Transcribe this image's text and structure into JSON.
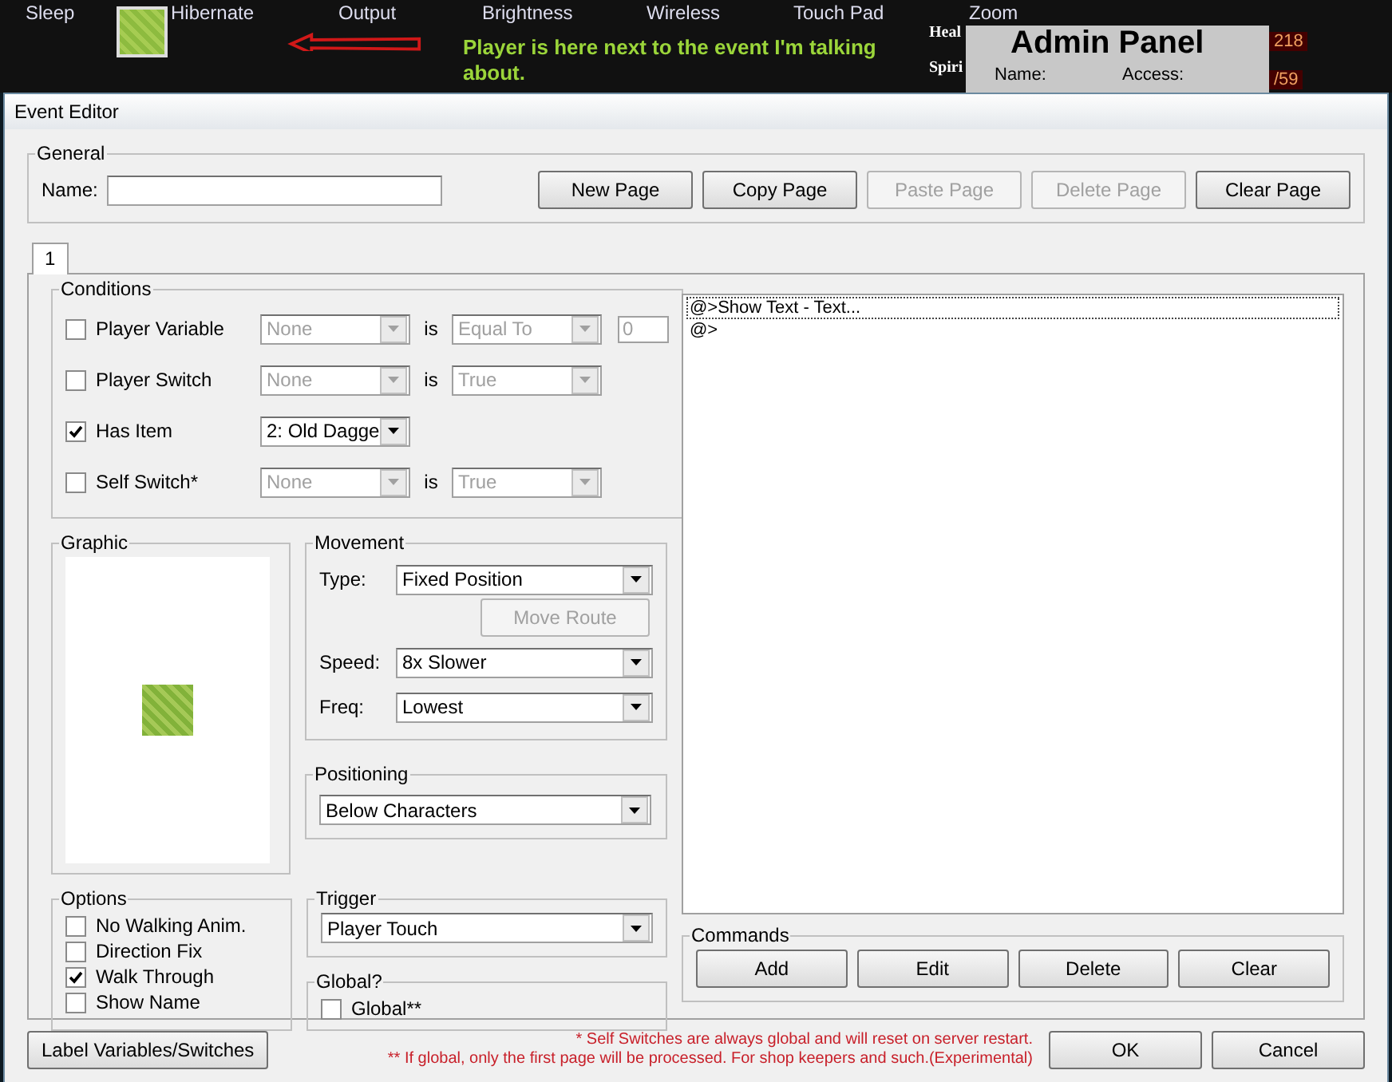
{
  "background": {
    "taskbar_items": [
      {
        "label": "Sleep"
      },
      {
        "label": "Hibernate"
      },
      {
        "label": "Output"
      },
      {
        "label": "Brightness"
      },
      {
        "label": "Wireless"
      },
      {
        "label": "Touch Pad"
      },
      {
        "label": "Zoom"
      }
    ],
    "annotation": "Player is here next to the event I'm talking about.",
    "stat_labels": [
      "Heal",
      "Spiri"
    ],
    "stat_values": [
      "218",
      "/59"
    ],
    "admin_panel": {
      "title": "Admin Panel",
      "labels": [
        "Name:",
        "Access:"
      ]
    }
  },
  "dialog": {
    "title": "Event Editor",
    "general": {
      "label": "General",
      "name_label": "Name:",
      "buttons": [
        {
          "label": "New Page",
          "disabled": false
        },
        {
          "label": "Copy Page",
          "disabled": false
        },
        {
          "label": "Paste Page",
          "disabled": true
        },
        {
          "label": "Delete Page",
          "disabled": true
        },
        {
          "label": "Clear Page",
          "disabled": false
        }
      ]
    },
    "tabs": [
      {
        "label": "1",
        "selected": true
      }
    ],
    "conditions": {
      "label": "Conditions",
      "rows": [
        {
          "label": "Player Variable",
          "checked": false,
          "controls": [
            {
              "kind": "select",
              "value": "None",
              "disabled": true
            },
            {
              "kind": "text",
              "text": "is"
            },
            {
              "kind": "select",
              "value": "Equal To",
              "disabled": true
            },
            {
              "kind": "input",
              "value": "0",
              "disabled": true
            }
          ]
        },
        {
          "label": "Player Switch",
          "checked": false,
          "controls": [
            {
              "kind": "select",
              "value": "None",
              "disabled": true
            },
            {
              "kind": "text",
              "text": "is"
            },
            {
              "kind": "select",
              "value": "True",
              "disabled": true
            }
          ]
        },
        {
          "label": "Has Item",
          "checked": true,
          "controls": [
            {
              "kind": "select",
              "value": "2: Old Dagge",
              "disabled": false
            }
          ]
        },
        {
          "label": "Self Switch*",
          "checked": false,
          "controls": [
            {
              "kind": "select",
              "value": "None",
              "disabled": true
            },
            {
              "kind": "text",
              "text": "is"
            },
            {
              "kind": "select",
              "value": "True",
              "disabled": true
            }
          ]
        }
      ]
    },
    "graphic": {
      "label": "Graphic"
    },
    "movement": {
      "label": "Movement",
      "type_label": "Type:",
      "type": "Fixed Position",
      "move_route": {
        "label": "Move Route",
        "disabled": true
      },
      "speed_label": "Speed:",
      "speed": "8x Slower",
      "freq_label": "Freq:",
      "freq": "Lowest"
    },
    "positioning": {
      "label": "Positioning",
      "value": "Below Characters"
    },
    "options": {
      "label": "Options",
      "items": [
        {
          "label": "No Walking Anim.",
          "checked": false
        },
        {
          "label": "Direction Fix",
          "checked": false
        },
        {
          "label": "Walk Through",
          "checked": true
        },
        {
          "label": "Show Name",
          "checked": false
        }
      ]
    },
    "trigger": {
      "label": "Trigger",
      "value": "Player Touch"
    },
    "global": {
      "label": "Global?",
      "checkbox": {
        "label": "Global**",
        "checked": false
      }
    },
    "command_list": [
      {
        "text": "@>Show Text - Text...",
        "selected": true
      },
      {
        "text": "@>",
        "selected": false
      }
    ],
    "commands": {
      "label": "Commands",
      "buttons": [
        "Add",
        "Edit",
        "Delete",
        "Clear"
      ]
    },
    "footer": {
      "button": "Label Variables/Switches",
      "notes": [
        "* Self Switches are always global and will reset on server restart.",
        "** If global, only the first page will be processed. For shop keepers and such.(Experimental)"
      ],
      "ok": "OK",
      "cancel": "Cancel"
    }
  }
}
